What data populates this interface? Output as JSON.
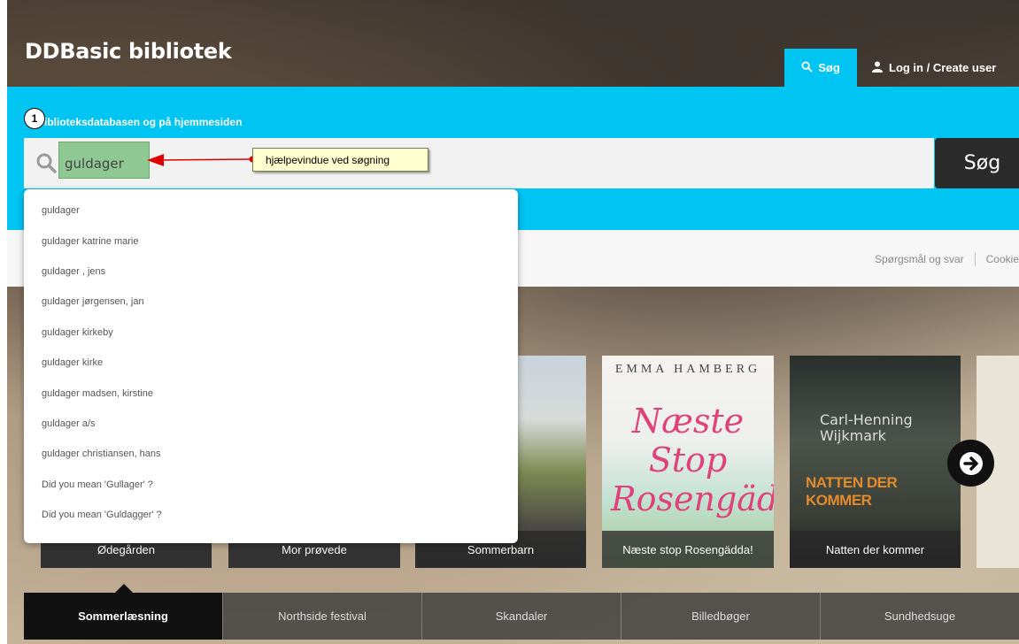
{
  "header": {
    "site_title": "DDBasic bibliotek",
    "tab_search_label": "Søg",
    "tab_login_label": "Log in / Create user"
  },
  "search": {
    "caption": "i biblioteksdatabasen og på hjemmesiden",
    "step_number": "1",
    "value": "guldager",
    "button_label": "Søg"
  },
  "annotation": {
    "text": "hjælpevindue ved søgning",
    "color": "#e00000"
  },
  "autocomplete": {
    "items": [
      "guldager",
      "guldager katrine marie",
      "guldager , jens",
      "guldager jørgensen, jan",
      "guldager kirkeby",
      "guldager kirke",
      "guldager madsen, kirstine",
      "guldager a/s",
      "guldager christiansen, hans",
      "Did you mean 'Gullager' ?",
      "Did you mean 'Guldagger' ?"
    ]
  },
  "links": {
    "faq": "Spørgsmål og svar",
    "cookie": "Cookie"
  },
  "covers": [
    {
      "caption": "Ødegården"
    },
    {
      "caption": "Mor prøvede"
    },
    {
      "caption": "Sommerbarn"
    },
    {
      "caption": "Næste stop Rosengädda!",
      "author": "EMMA HAMBERG",
      "cover_title": "Næste Stop Rosengädda"
    },
    {
      "caption": "Natten der kommer",
      "author": "Carl-Henning Wijkmark",
      "cover_title": "NATTEN DER KOMMER"
    }
  ],
  "categories": [
    "Sommerlæsning",
    "Northside festival",
    "Skandaler",
    "Billedbøger",
    "Sundhedsuge"
  ],
  "colors": {
    "accent": "#00c4f2",
    "button_dark": "#2b2b2b",
    "highlight": "#8fc893"
  }
}
